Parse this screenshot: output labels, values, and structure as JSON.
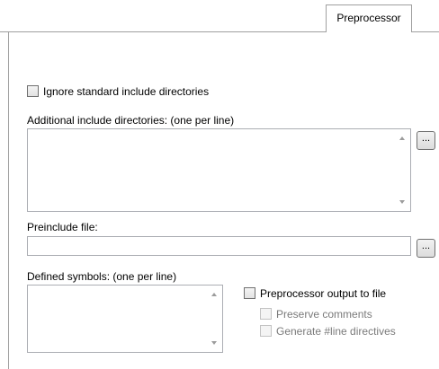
{
  "tabs": {
    "preprocessor": "Preprocessor"
  },
  "ignore_standard": {
    "label": "Ignore standard include directories",
    "checked": false
  },
  "additional_include": {
    "label": "Additional include directories: (one per line)",
    "value": "",
    "browse_label": "..."
  },
  "preinclude": {
    "label": "Preinclude file:",
    "value": "",
    "browse_label": "..."
  },
  "defined_symbols": {
    "label": "Defined symbols: (one per line)",
    "value": ""
  },
  "preprocessor_output": {
    "label": "Preprocessor output to file",
    "checked": false
  },
  "preserve_comments": {
    "label": "Preserve comments",
    "checked": false,
    "enabled": false
  },
  "generate_line": {
    "label": "Generate #line directives",
    "checked": false,
    "enabled": false
  }
}
